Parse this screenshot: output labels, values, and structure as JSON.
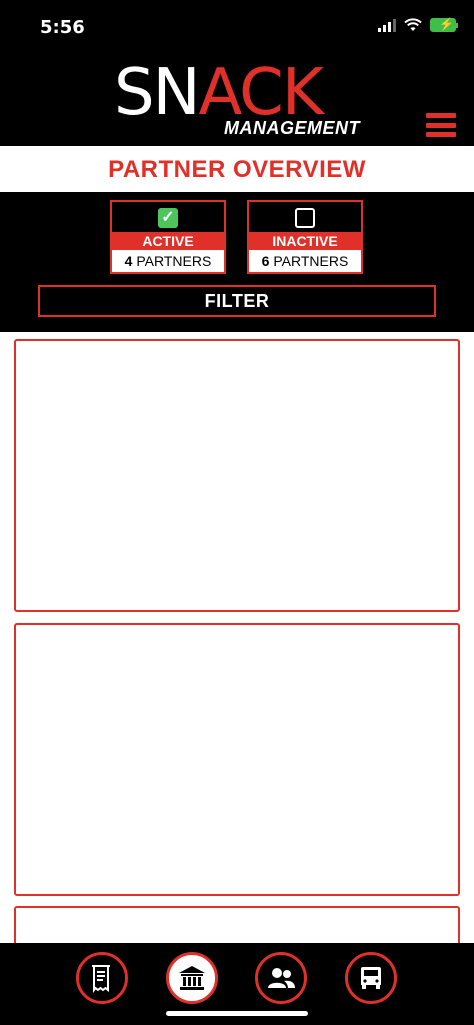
{
  "status_bar": {
    "time": "5:56"
  },
  "header": {
    "logo_sn": "SN",
    "logo_ack": "ACK",
    "logo_sub": "MANAGEMENT"
  },
  "page": {
    "title": "PARTNER OVERVIEW"
  },
  "filters": {
    "active": {
      "label": "ACTIVE",
      "count": "4",
      "unit": "PARTNERS",
      "checked": true
    },
    "inactive": {
      "label": "INACTIVE",
      "count": "6",
      "unit": "PARTNERS",
      "checked": false
    },
    "filter_button": "FILTER"
  },
  "nav": {
    "items": [
      {
        "icon": "receipt-icon",
        "active": false
      },
      {
        "icon": "bank-icon",
        "active": true
      },
      {
        "icon": "users-icon",
        "active": false
      },
      {
        "icon": "van-icon",
        "active": false
      }
    ]
  },
  "colors": {
    "accent": "#e0302a",
    "background": "#000000",
    "check": "#4cc55a"
  }
}
